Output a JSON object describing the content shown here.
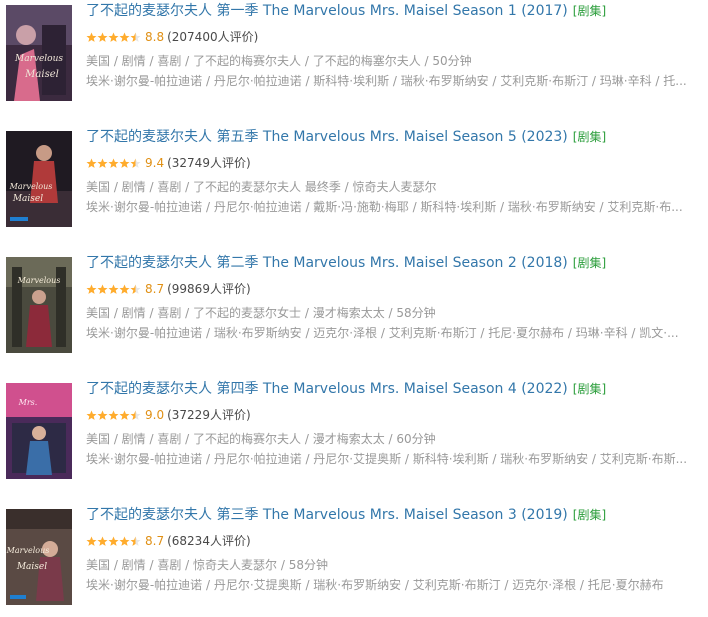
{
  "badge_label": "[剧集]",
  "colors": {
    "link": "#3377aa",
    "badge": "#2a9d3a",
    "score": "#e09015",
    "star_fill": "#ffac2d",
    "meta": "#999999"
  },
  "icons": {
    "rating_stars": "star-rating-icon",
    "poster": "poster-image"
  },
  "results": [
    {
      "title": "了不起的麦瑟尔夫人 第一季 The Marvelous Mrs. Maisel Season 1 (2017)",
      "stars": 4.5,
      "score": "8.8",
      "votes": "(207400人评价)",
      "meta": "美国 / 剧情 / 喜剧 / 了不起的梅赛尔夫人 / 了不起的梅塞尔夫人 / 50分钟",
      "cast": "埃米·谢尔曼-帕拉迪诺 / 丹尼尔·帕拉迪诺 / 斯科特·埃利斯 / 瑞秋·布罗斯纳安 / 艾利克斯·布斯汀 / 玛琳·辛科 / 托..."
    },
    {
      "title": "了不起的麦瑟尔夫人 第五季 The Marvelous Mrs. Maisel Season 5 (2023)",
      "stars": 4.5,
      "score": "9.4",
      "votes": "(32749人评价)",
      "meta": "美国 / 剧情 / 喜剧 / 了不起的麦瑟尔夫人 最终季 / 惊奇夫人麦瑟尔",
      "cast": "埃米·谢尔曼-帕拉迪诺 / 丹尼尔·帕拉迪诺 / 戴斯·冯·施勒·梅耶 / 斯科特·埃利斯 / 瑞秋·布罗斯纳安 / 艾利克斯·布..."
    },
    {
      "title": "了不起的麦瑟尔夫人 第二季 The Marvelous Mrs. Maisel Season 2 (2018)",
      "stars": 4.5,
      "score": "8.7",
      "votes": "(99869人评价)",
      "meta": "美国 / 剧情 / 喜剧 / 了不起的麦瑟尔女士 / 漫才梅索太太 / 58分钟",
      "cast": "埃米·谢尔曼-帕拉迪诺 / 瑞秋·布罗斯纳安 / 迈克尔·泽根 / 艾利克斯·布斯汀 / 托尼·夏尔赫布 / 玛琳·辛科 / 凯文·..."
    },
    {
      "title": "了不起的麦瑟尔夫人 第四季 The Marvelous Mrs. Maisel Season 4 (2022)",
      "stars": 4.5,
      "score": "9.0",
      "votes": "(37229人评价)",
      "meta": "美国 / 剧情 / 喜剧 / 了不起的梅赛尔夫人 / 漫才梅索太太 / 60分钟",
      "cast": "埃米·谢尔曼-帕拉迪诺 / 丹尼尔·帕拉迪诺 / 丹尼尔·艾提奥斯 / 斯科特·埃利斯 / 瑞秋·布罗斯纳安 / 艾利克斯·布斯..."
    },
    {
      "title": "了不起的麦瑟尔夫人 第三季 The Marvelous Mrs. Maisel Season 3 (2019)",
      "stars": 4.5,
      "score": "8.7",
      "votes": "(68234人评价)",
      "meta": "美国 / 剧情 / 喜剧 / 惊奇夫人麦瑟尔 / 58分钟",
      "cast": "埃米·谢尔曼-帕拉迪诺 / 丹尼尔·艾提奥斯 / 瑞秋·布罗斯纳安 / 艾利克斯·布斯汀 / 迈克尔·泽根 / 托尼·夏尔赫布"
    }
  ]
}
